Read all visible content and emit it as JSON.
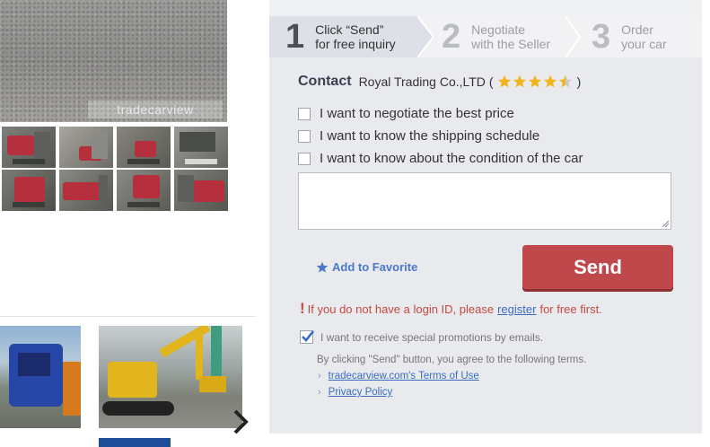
{
  "gallery": {
    "watermark": "tradecarview",
    "thumbnail_count": 8
  },
  "similar": {
    "next_icon": "chevron-right-icon"
  },
  "inquiry": {
    "steps": [
      {
        "num": "1",
        "line1": "Click “Send”",
        "line2": "for free inquiry"
      },
      {
        "num": "2",
        "line1": "Negotiate",
        "line2": "with the Seller"
      },
      {
        "num": "3",
        "line1": "Order",
        "line2": "your car"
      }
    ],
    "contact_label": "Contact",
    "company": "Royal Trading Co.,LTD",
    "paren_open": "(",
    "paren_close": ")",
    "rating": 4.5,
    "options": [
      "I want to negotiate the best price",
      "I want to know the shipping schedule",
      "I want to know about the condition of the car"
    ],
    "message_value": "",
    "favorite_label": "Add to Favorite",
    "send_label": "Send",
    "login_note": {
      "before": "If you do not have a login ID, please",
      "link": "register",
      "after": "for free first."
    },
    "promo_label": "I want to receive special promotions by emails.",
    "promo_checked": true,
    "terms_text": "By clicking \"Send\" button, you agree to the following terms.",
    "terms_links": [
      "tradecarview.com's Terms of Use",
      "Privacy Policy"
    ]
  },
  "colors": {
    "panel_bg": "#e9eaee",
    "send_button": "#c0484a",
    "link": "#3a6cc1",
    "star": "#f3b41b",
    "warning": "#c24a3e"
  }
}
